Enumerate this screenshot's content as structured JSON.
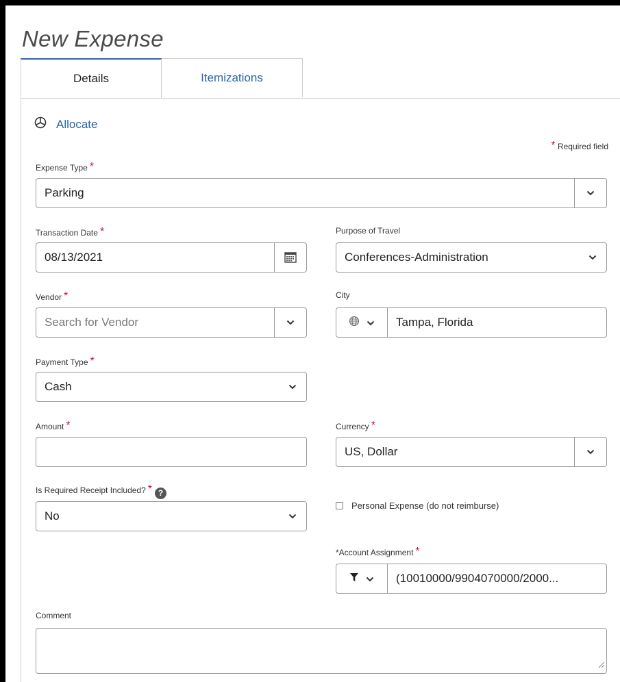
{
  "page_title": "New Expense",
  "tabs": [
    {
      "label": "Details",
      "active": true
    },
    {
      "label": "Itemizations",
      "active": false
    }
  ],
  "allocate_label": "Allocate",
  "required_note": "Required field",
  "required_marker": "*",
  "fields": {
    "expense_type": {
      "label": "Expense Type",
      "value": "Parking"
    },
    "transaction_date": {
      "label": "Transaction Date",
      "value": "08/13/2021"
    },
    "purpose_of_travel": {
      "label": "Purpose of Travel",
      "value": "Conferences-Administration"
    },
    "vendor": {
      "label": "Vendor",
      "placeholder": "Search for Vendor"
    },
    "city": {
      "label": "City",
      "value": "Tampa, Florida"
    },
    "payment_type": {
      "label": "Payment Type",
      "value": "Cash"
    },
    "amount": {
      "label": "Amount",
      "value": ""
    },
    "currency": {
      "label": "Currency",
      "value": "US, Dollar"
    },
    "receipt_included": {
      "label": "Is Required Receipt Included?",
      "value": "No"
    },
    "personal_expense": {
      "label": "Personal Expense (do not reimburse)",
      "checked": false
    },
    "account_assignment": {
      "label": "*Account Assignment",
      "value": "(10010000/9904070000/2000..."
    },
    "comment": {
      "label": "Comment",
      "value": ""
    }
  },
  "colors": {
    "accent": "#2a65a8",
    "required": "#c8102e",
    "border": "#9a9a9a"
  },
  "icons": [
    "allocate-icon",
    "calendar-icon",
    "globe-icon",
    "filter-icon",
    "help-icon",
    "chevron-down-icon",
    "resize-grip-icon"
  ]
}
